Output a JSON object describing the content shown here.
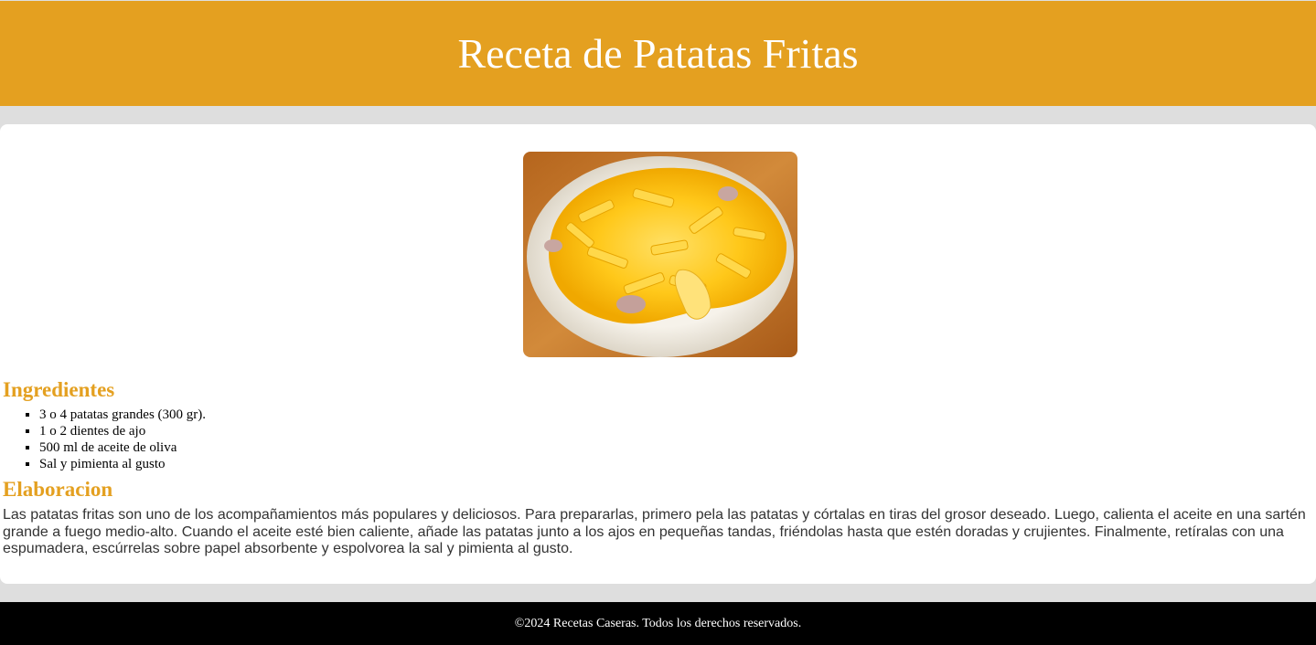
{
  "header": {
    "title": "Receta de Patatas Fritas"
  },
  "image": {
    "icon": "fried-potatoes-photo"
  },
  "ingredients": {
    "title": "Ingredientes",
    "items": [
      "3 o 4 patatas grandes (300 gr).",
      "1 o 2 dientes de ajo",
      "500 ml de aceite de oliva",
      "Sal y pimienta al gusto"
    ]
  },
  "elaboracion": {
    "title": "Elaboracion",
    "text": "Las patatas fritas son uno de los acompañamientos más populares y deliciosos. Para prepararlas, primero pela las patatas y córtalas en tiras del grosor deseado. Luego, calienta el aceite en una sartén grande a fuego medio-alto. Cuando el aceite esté bien caliente, añade las patatas junto a los ajos en pequeñas tandas, friéndolas hasta que estén doradas y crujientes. Finalmente, retíralas con una espumadera, escúrrelas sobre papel absorbente y espolvorea la sal y pimienta al gusto."
  },
  "footer": {
    "text": "©2024 Recetas Caseras. Todos los derechos reservados."
  },
  "colors": {
    "accent": "#e4a020",
    "background": "#dedede",
    "footer": "#000000"
  }
}
